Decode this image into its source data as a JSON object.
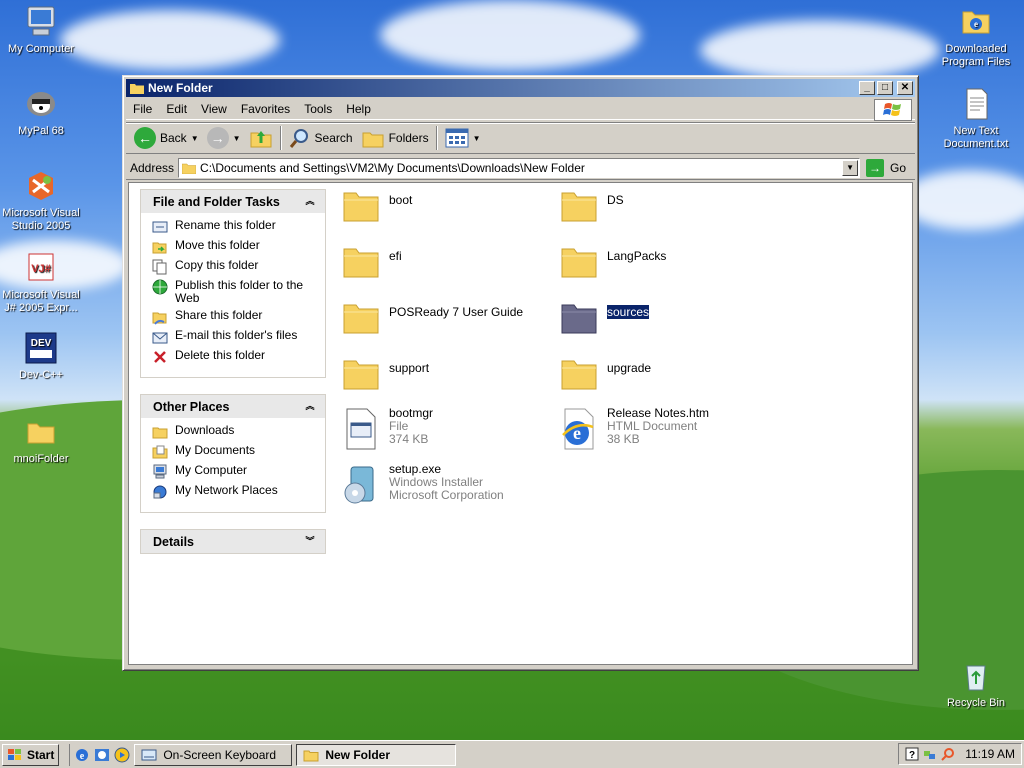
{
  "desktop": {
    "icons_left": [
      {
        "label": "My Computer",
        "icon": "my-computer-icon"
      },
      {
        "label": "MyPal 68",
        "icon": "mypal-icon"
      },
      {
        "label": "Microsoft Visual Studio 2005",
        "icon": "visual-studio-icon"
      },
      {
        "label": "Microsoft Visual J# 2005 Expr...",
        "icon": "visual-jsharp-icon"
      },
      {
        "label": "Dev-C++",
        "icon": "dev-cpp-icon"
      },
      {
        "label": "mnoiFolder",
        "icon": "folder-icon"
      }
    ],
    "icons_right": [
      {
        "label": "Downloaded Program Files",
        "icon": "ie-folder-icon"
      },
      {
        "label": "New Text Document.txt",
        "icon": "text-document-icon"
      },
      {
        "label": "Recycle Bin",
        "icon": "recycle-bin-icon"
      }
    ]
  },
  "window": {
    "title": "New Folder",
    "menu": [
      "File",
      "Edit",
      "View",
      "Favorites",
      "Tools",
      "Help"
    ],
    "toolbar": {
      "back_label": "Back",
      "search_label": "Search",
      "folders_label": "Folders"
    },
    "address": {
      "label": "Address",
      "value": "C:\\Documents and Settings\\VM2\\My Documents\\Downloads\\New Folder",
      "go_label": "Go"
    },
    "tasks_panel": {
      "title": "File and Folder Tasks",
      "items": [
        "Rename this folder",
        "Move this folder",
        "Copy this folder",
        "Publish this folder to the Web",
        "Share this folder",
        "E-mail this folder's files",
        "Delete this folder"
      ]
    },
    "places_panel": {
      "title": "Other Places",
      "items": [
        "Downloads",
        "My Documents",
        "My Computer",
        "My Network Places"
      ]
    },
    "details_panel": {
      "title": "Details"
    },
    "files": [
      {
        "name": "boot",
        "type": "folder"
      },
      {
        "name": "DS",
        "type": "folder"
      },
      {
        "name": "efi",
        "type": "folder"
      },
      {
        "name": "LangPacks",
        "type": "folder"
      },
      {
        "name": "POSReady 7 User Guide",
        "type": "folder"
      },
      {
        "name": "sources",
        "type": "folder",
        "selected": true
      },
      {
        "name": "support",
        "type": "folder"
      },
      {
        "name": "upgrade",
        "type": "folder"
      },
      {
        "name": "bootmgr",
        "line2": "File",
        "line3": "374 KB",
        "type": "file"
      },
      {
        "name": "Release Notes.htm",
        "line2": "HTML Document",
        "line3": "38 KB",
        "type": "html"
      },
      {
        "name": "setup.exe",
        "line2": "Windows Installer",
        "line3": "Microsoft Corporation",
        "type": "installer"
      }
    ]
  },
  "taskbar": {
    "start_label": "Start",
    "tasks": [
      {
        "label": "On-Screen Keyboard",
        "active": false
      },
      {
        "label": "New Folder",
        "active": true
      }
    ],
    "clock": "11:19 AM"
  },
  "colors": {
    "title_bar": "#0a246a",
    "selection": "#0a246a",
    "folder_yellow": "#f6d160",
    "window_face": "#d4d0c8"
  }
}
